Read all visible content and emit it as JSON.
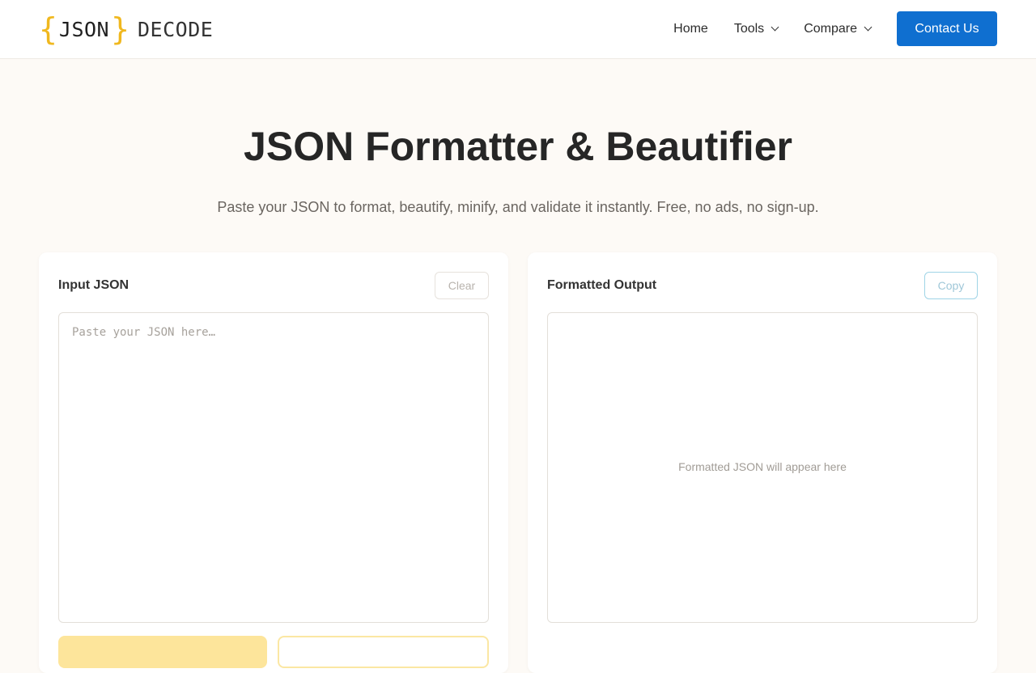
{
  "header": {
    "logo": {
      "brace_open": "{",
      "word1": "JSON",
      "brace_close": "}",
      "word2": "DECODE"
    },
    "nav": [
      {
        "label": "Home",
        "has_dropdown": false
      },
      {
        "label": "Tools",
        "has_dropdown": true
      },
      {
        "label": "Compare",
        "has_dropdown": true
      }
    ],
    "cta_label": "Contact Us"
  },
  "hero": {
    "title": "JSON Formatter & Beautifier",
    "subtitle": "Paste your JSON to format, beautify, minify, and validate it instantly. Free, no ads, no sign-up."
  },
  "input_panel": {
    "title": "Input JSON",
    "clear_label": "Clear",
    "placeholder": "Paste your JSON here…",
    "value": ""
  },
  "output_panel": {
    "title": "Formatted Output",
    "copy_label": "Copy",
    "placeholder": "Formatted JSON will appear here"
  },
  "colors": {
    "accent": "#0f6fd0",
    "logo_brace": "#f0b81f",
    "primary_action": "#fde59b",
    "background": "#fdfaf6"
  },
  "icons": [
    "chevron-down-icon"
  ]
}
